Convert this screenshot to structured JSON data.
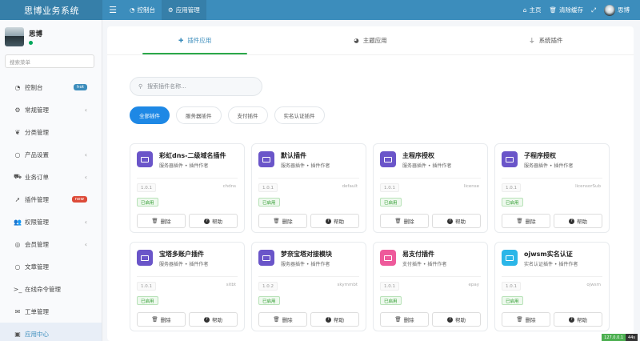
{
  "header": {
    "brand": "思博业务系统",
    "tabs": [
      {
        "label": "控制台"
      },
      {
        "label": "应用管理"
      }
    ],
    "links": [
      {
        "label": "主页"
      },
      {
        "label": "清除缓存"
      }
    ],
    "user_name": "思博"
  },
  "sidebar": {
    "user_name": "思博",
    "search_placeholder": "搜索菜单",
    "items": [
      {
        "label": "控制台",
        "badge": "hot",
        "badge_color": "#3c8dbc"
      },
      {
        "label": "常规管理"
      },
      {
        "label": "分类管理"
      },
      {
        "label": "产品设置"
      },
      {
        "label": "业务订单"
      },
      {
        "label": "插件管理",
        "badge": "new",
        "badge_color": "#dd4b39"
      },
      {
        "label": "权限管理"
      },
      {
        "label": "会员管理"
      },
      {
        "label": "文章管理"
      },
      {
        "label": "在线命令管理"
      },
      {
        "label": "工单管理"
      },
      {
        "label": "应用中心"
      }
    ]
  },
  "main": {
    "tabs": [
      {
        "label": "插件应用"
      },
      {
        "label": "主题应用"
      },
      {
        "label": "系统插件"
      }
    ],
    "search_placeholder": "搜索插件名称...",
    "filters": [
      {
        "label": "全部插件"
      },
      {
        "label": "服务器插件"
      },
      {
        "label": "支付插件"
      },
      {
        "label": "实名认证插件"
      }
    ],
    "delete_label": "删除",
    "help_label": "帮助",
    "plugins": [
      {
        "name": "彩虹dns-二级域名插件",
        "meta": "服务器插件 • 插件作者",
        "version": "1.0.1",
        "slug": "chdns",
        "status": "已启用",
        "icon_color": "#6a55c9"
      },
      {
        "name": "默认插件",
        "meta": "服务器插件 • 插件作者",
        "version": "1.0.1",
        "slug": "default",
        "status": "已启用",
        "icon_color": "#6a55c9"
      },
      {
        "name": "主程序授权",
        "meta": "服务器插件 • 插件作者",
        "version": "1.0.1",
        "slug": "license",
        "status": "已启用",
        "icon_color": "#6a55c9"
      },
      {
        "name": "子程序授权",
        "meta": "服务器插件 • 插件作者",
        "version": "1.0.1",
        "slug": "licensorSub",
        "status": "已启用",
        "icon_color": "#6a55c9"
      },
      {
        "name": "宝塔多账户插件",
        "meta": "服务器插件 • 插件作者",
        "version": "1.0.1",
        "slug": "sitbt",
        "status": "已启用",
        "icon_color": "#6a55c9"
      },
      {
        "name": "梦奈宝塔对接模块",
        "meta": "服务器插件 • 插件作者",
        "version": "1.0.2",
        "slug": "skymmbt",
        "status": "已启用",
        "icon_color": "#6a55c9"
      },
      {
        "name": "易支付插件",
        "meta": "支付插件 • 插件作者",
        "version": "1.0.1",
        "slug": "epay",
        "status": "已启用",
        "icon_color": "#ee5a9b"
      },
      {
        "name": "ojwsm实名认证",
        "meta": "实名认证插件 • 插件作者",
        "version": "1.0.1",
        "slug": "ojwsm",
        "status": "已启用",
        "icon_color": "#2bb6e8"
      }
    ]
  },
  "corner": {
    "ip": "127.0.0.1",
    "time": "44s"
  }
}
